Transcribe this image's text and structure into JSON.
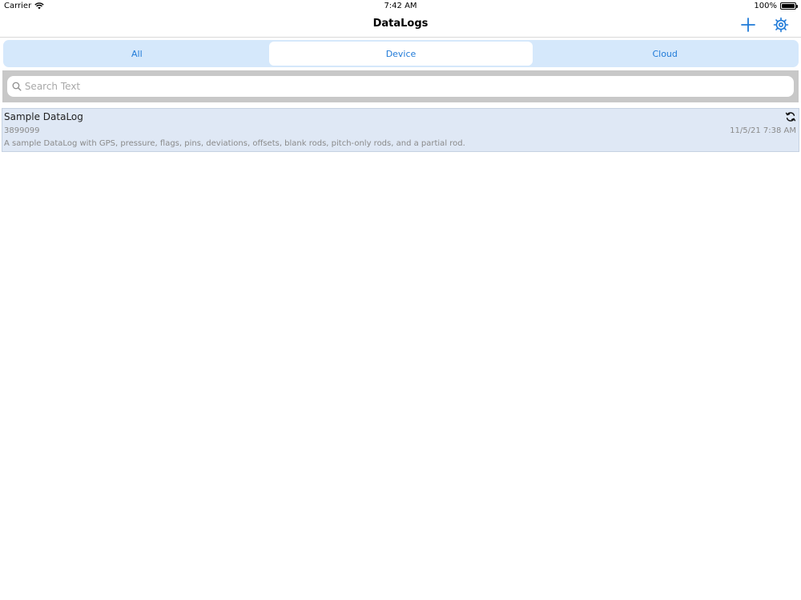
{
  "status_bar": {
    "carrier": "Carrier",
    "time": "7:42 AM",
    "battery": "100%"
  },
  "nav": {
    "title": "DataLogs",
    "add_icon": "plus-icon",
    "settings_icon": "gear-icon"
  },
  "segments": [
    {
      "label": "All",
      "selected": false
    },
    {
      "label": "Device",
      "selected": true
    },
    {
      "label": "Cloud",
      "selected": false
    }
  ],
  "search": {
    "placeholder": "Search Text",
    "value": ""
  },
  "datalogs": [
    {
      "title": "Sample DataLog",
      "id": "3899099",
      "date": "11/5/21 7:38 AM",
      "description": "A sample DataLog with GPS, pressure, flags, pins, deviations, offsets, blank rods, pitch-only rods, and a partial rod.",
      "status_icon": "sync-icon"
    }
  ],
  "colors": {
    "accent": "#1f7ad8",
    "segment_bg": "#d5e8fb",
    "row_bg": "#dfe8f5",
    "search_bg": "#c8c8c8"
  }
}
